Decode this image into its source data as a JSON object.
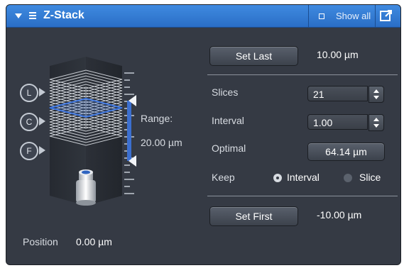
{
  "titlebar": {
    "title": "Z-Stack",
    "show_all_label": "Show all"
  },
  "stack_controls": {
    "last_label": "L",
    "center_label": "C",
    "first_label": "F"
  },
  "range": {
    "label": "Range:",
    "value": "20.00 µm"
  },
  "position": {
    "label": "Position",
    "value": "0.00 µm"
  },
  "set_last": {
    "button_label": "Set Last",
    "value": "10.00 µm"
  },
  "slices": {
    "label": "Slices",
    "value": "21"
  },
  "interval": {
    "label": "Interval",
    "value": "1.00"
  },
  "optimal": {
    "label": "Optimal",
    "button_label": "64.14 µm"
  },
  "keep": {
    "label": "Keep",
    "options": [
      "Interval",
      "Slice"
    ],
    "selected": "Interval"
  },
  "set_first": {
    "button_label": "Set First",
    "value": "-10.00 µm"
  },
  "colors": {
    "title_bar": "#2f78d4",
    "panel": "#353a44",
    "accent_blue": "#3c6fd0"
  }
}
